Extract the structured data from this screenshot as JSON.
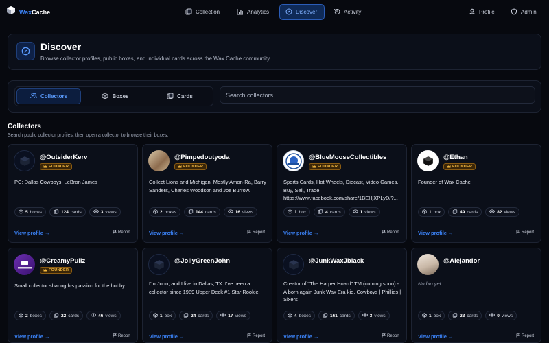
{
  "brand": {
    "prefix": "Wax",
    "name": "Cache"
  },
  "nav": {
    "collection": "Collection",
    "analytics": "Analytics",
    "discover": "Discover",
    "activity": "Activity",
    "profile": "Profile",
    "admin": "Admin"
  },
  "hero": {
    "title": "Discover",
    "subtitle": "Browse collector profiles, public boxes, and individual cards across the Wax Cache community."
  },
  "tabs": {
    "collectors": "Collectors",
    "boxes": "Boxes",
    "cards": "Cards"
  },
  "search": {
    "placeholder": "Search collectors..."
  },
  "section": {
    "title": "Collectors",
    "subtitle": "Search public collector profiles, then open a collector to browse their boxes."
  },
  "card_labels": {
    "founder": "FOUNDER",
    "view_profile": "View profile →",
    "report": "Report"
  },
  "collectors": [
    {
      "username": "@OutsiderKerv",
      "founder": true,
      "bio": "PC: Dallas Cowboys, LeBron James",
      "boxes": "5",
      "boxes_label": "boxes",
      "cards": "124",
      "cards_label": "cards",
      "views": "3",
      "views_label": "views"
    },
    {
      "username": "@Pimpedoutyoda",
      "founder": true,
      "bio": "Collect Lions and Michigan. Mostly Amon-Ra, Barry Sanders, Charles Woodson and Joe Burrow.",
      "boxes": "2",
      "boxes_label": "boxes",
      "cards": "144",
      "cards_label": "cards",
      "views": "16",
      "views_label": "views"
    },
    {
      "username": "@BlueMooseCollectibles",
      "founder": true,
      "bio": "Sports Cards, Hot Wheels, Diecast, Video Games. Buy, Sell, Trade https://www.facebook.com/share/1BEHjXPLyD/?...",
      "boxes": "1",
      "boxes_label": "box",
      "cards": "4",
      "cards_label": "cards",
      "views": "1",
      "views_label": "views"
    },
    {
      "username": "@Ethan",
      "founder": true,
      "bio": "Founder of Wax Cache",
      "boxes": "1",
      "boxes_label": "box",
      "cards": "49",
      "cards_label": "cards",
      "views": "82",
      "views_label": "views"
    },
    {
      "username": "@CreamyPullz",
      "founder": true,
      "bio": "Small collector sharing his passion for the hobby.",
      "boxes": "2",
      "boxes_label": "boxes",
      "cards": "22",
      "cards_label": "cards",
      "views": "46",
      "views_label": "views"
    },
    {
      "username": "@JollyGreenJohn",
      "founder": false,
      "bio": "I'm John, and I live in Dallas, TX. I've been a collector since 1989 Upper Deck #1 Star Rookie.",
      "boxes": "1",
      "boxes_label": "box",
      "cards": "24",
      "cards_label": "cards",
      "views": "17",
      "views_label": "views"
    },
    {
      "username": "@JunkWaxJblack",
      "founder": false,
      "bio": "Creator of \"The Harper Hoard\" TM (coming soon) - A born again Junk Wax Era kid. Cowboys | Phillies | Sixers",
      "boxes": "4",
      "boxes_label": "boxes",
      "cards": "161",
      "cards_label": "cards",
      "views": "3",
      "views_label": "views"
    },
    {
      "username": "@Alejandor",
      "founder": false,
      "bio": "No bio yet.",
      "boxes": "1",
      "boxes_label": "box",
      "cards": "23",
      "cards_label": "cards",
      "views": "0",
      "views_label": "views"
    }
  ],
  "colors": {
    "accent": "#3b82f6",
    "founder": "#f5b941",
    "background": "#07090f"
  },
  "icons": {
    "brand": "wax-cache-logo-icon",
    "collection": "cards-stack-icon",
    "analytics": "bar-chart-icon",
    "discover": "compass-icon",
    "activity": "history-icon",
    "profile": "user-icon",
    "admin": "shield-icon",
    "collectors": "users-icon",
    "boxes": "box-icon",
    "cards": "cards-stack-icon",
    "founder": "crown-icon",
    "views": "eye-icon",
    "report": "flag-icon"
  }
}
